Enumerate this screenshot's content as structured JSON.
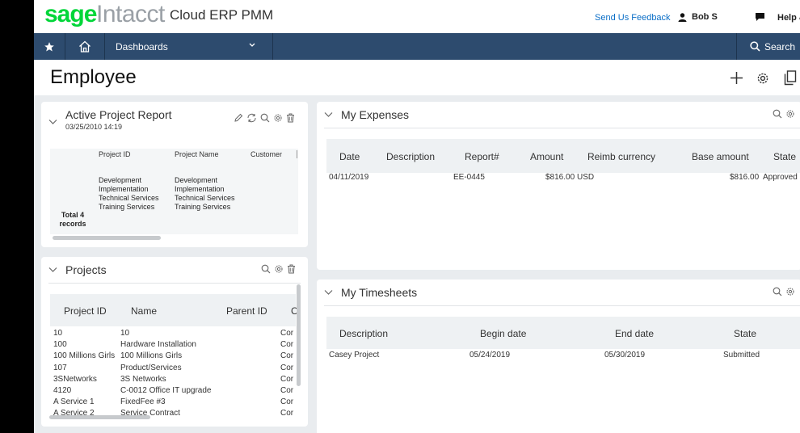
{
  "brand": {
    "sage": "sage",
    "intacct": "Intacct",
    "product": "Cloud ERP PMM",
    "sage_color": "#00d639"
  },
  "topbar": {
    "feedback": "Send Us Feedback",
    "user": "Bob S",
    "help": "Help &"
  },
  "nav": {
    "dashboards": "Dashboards",
    "search": "Search",
    "bg_color": "#2d4b6e"
  },
  "page": {
    "title": "Employee"
  },
  "active_project_report": {
    "title": "Active Project Report",
    "date": "03/25/2010 14:19",
    "columns": [
      "Project ID",
      "Project Name",
      "Customer"
    ],
    "project_ids": [
      "Development",
      "Implementation",
      "Technical Services",
      "Training Services"
    ],
    "project_names": [
      "Development",
      "Implementation",
      "Technical Services",
      "Training Services"
    ],
    "total_line1": "Total 4",
    "total_line2": "records"
  },
  "projects": {
    "title": "Projects",
    "columns": [
      "Project ID",
      "Name",
      "Parent ID",
      "C"
    ],
    "rows": [
      {
        "id": "10",
        "name": "10",
        "c": "Cor"
      },
      {
        "id": "100",
        "name": "Hardware Installation",
        "c": "Cor"
      },
      {
        "id": "100 Millions Girls",
        "name": "100 Millions Girls",
        "c": "Cor"
      },
      {
        "id": "107",
        "name": "Product/Services",
        "c": "Cor"
      },
      {
        "id": "3SNetworks",
        "name": "3S Networks",
        "c": "Cor"
      },
      {
        "id": "4120",
        "name": "C-0012 Office IT upgrade",
        "c": "Cor"
      },
      {
        "id": "A Service 1",
        "name": "FixedFee #3",
        "c": "Cor"
      },
      {
        "id": "A Service 2",
        "name": "Service Contract",
        "c": "Cor"
      }
    ]
  },
  "expenses": {
    "title": "My Expenses",
    "columns": [
      "Date",
      "Description",
      "Report#",
      "Amount",
      "Reimb currency",
      "Base amount",
      "State"
    ],
    "rows": [
      {
        "date": "04/11/2019",
        "description": "",
        "report": "EE-0445",
        "amount": "$816.00",
        "currency": "USD",
        "base": "$816.00",
        "state": "Approved"
      }
    ]
  },
  "timesheets": {
    "title": "My Timesheets",
    "columns": [
      "Description",
      "Begin date",
      "End date",
      "State"
    ],
    "rows": [
      {
        "description": "Casey Project",
        "begin": "05/24/2019",
        "end": "05/30/2019",
        "state": "Submitted"
      }
    ]
  }
}
